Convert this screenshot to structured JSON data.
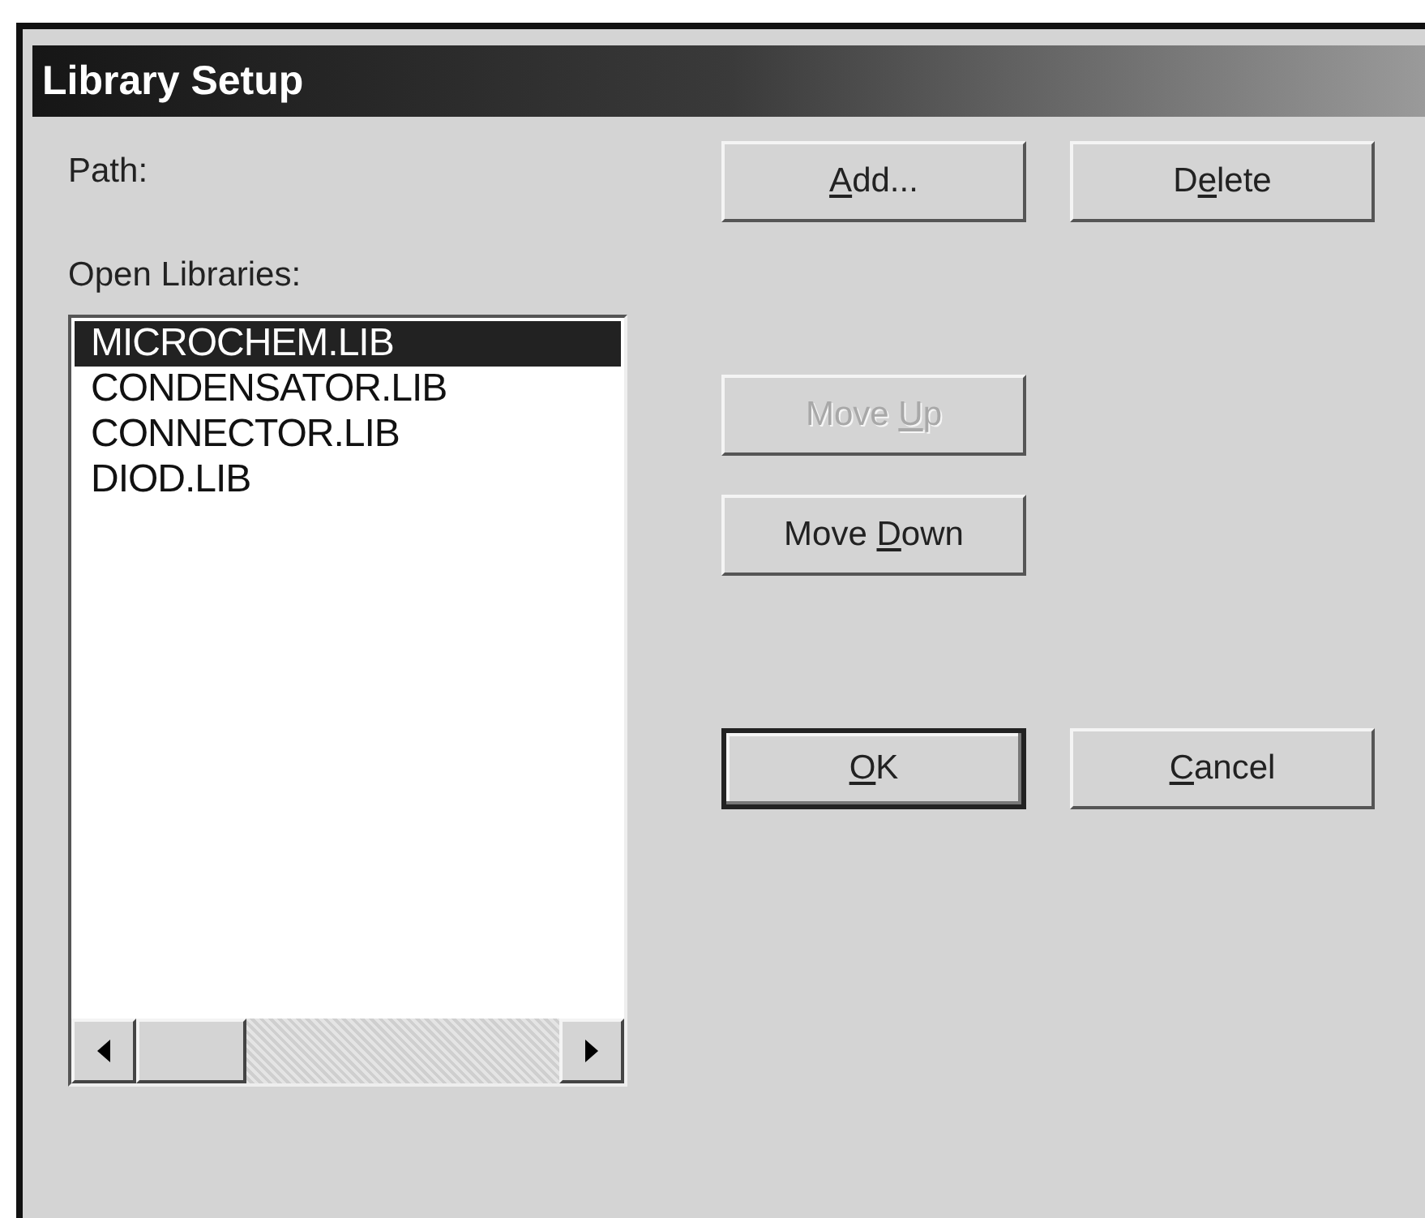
{
  "window": {
    "title": "Library Setup"
  },
  "path_label": "Path:",
  "libraries_label": "Open Libraries:",
  "libraries": [
    {
      "name": "MICROCHEM.LIB",
      "selected": true
    },
    {
      "name": "CONDENSATOR.LIB",
      "selected": false
    },
    {
      "name": "CONNECTOR.LIB",
      "selected": false
    },
    {
      "name": "DIOD.LIB",
      "selected": false
    }
  ],
  "buttons": [
    {
      "kind": "add",
      "label": {
        "access_key": "A",
        "after": "dd..."
      },
      "disabled": false,
      "default": false
    },
    {
      "kind": "delete",
      "label": {
        "before": "D",
        "access_key": "e",
        "after": "lete"
      },
      "disabled": false,
      "default": false
    },
    {
      "kind": "move_up",
      "label": {
        "before": "Move ",
        "access_key": "U",
        "after": "p"
      },
      "disabled": true,
      "default": false
    },
    {
      "kind": "move_down",
      "label": {
        "before": "Move ",
        "access_key": "D",
        "after": "own"
      },
      "disabled": false,
      "default": false
    },
    {
      "kind": "ok",
      "label": {
        "access_key": "O",
        "after": "K"
      },
      "disabled": false,
      "default": true
    },
    {
      "kind": "cancel",
      "label": {
        "access_key": "C",
        "after": "ancel"
      },
      "disabled": false,
      "default": false
    }
  ]
}
